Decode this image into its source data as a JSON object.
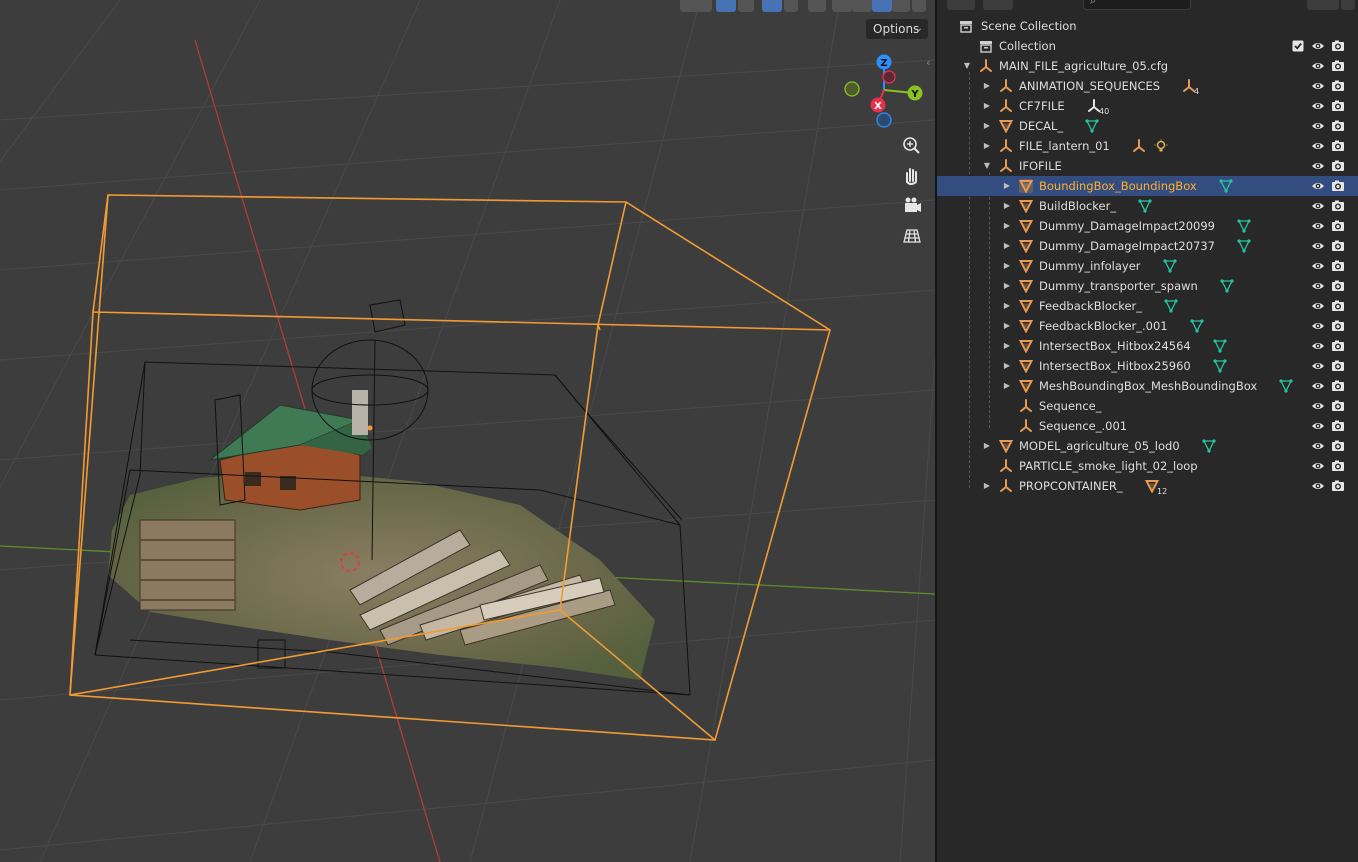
{
  "viewport": {
    "options_label": "Options",
    "header_buttons": [
      "transform-pivot",
      "snap",
      "proportional-edit",
      "overlays",
      "xray",
      "shading-wireframe",
      "shading-solid",
      "shading-material",
      "shading-rendered"
    ]
  },
  "gizmo": {
    "x_label": "X",
    "y_label": "Y",
    "z_label": "Z",
    "colors": {
      "x": "#e6314a",
      "y": "#8ac222",
      "z": "#2c8fff",
      "neg_y": "#637e2a"
    }
  },
  "nav_tools": [
    "zoom-icon",
    "hand-pan-icon",
    "camera-icon",
    "grid-perspective-icon"
  ],
  "outliner": {
    "search_placeholder": "",
    "scene_collection_label": "Scene Collection",
    "rows": [
      {
        "label": "Collection",
        "type": "collection",
        "depth": 1,
        "expand": "",
        "extras": [],
        "checkbox": true
      },
      {
        "label": "MAIN_FILE_agriculture_05.cfg",
        "type": "empty",
        "depth": 1,
        "expand": "down",
        "extras": []
      },
      {
        "label": "ANIMATION_SEQUENCES",
        "type": "empty",
        "depth": 2,
        "expand": "right",
        "extras": [
          {
            "icon": "empty",
            "count": "4"
          }
        ]
      },
      {
        "label": "CF7FILE",
        "type": "empty",
        "depth": 2,
        "expand": "right",
        "extras": [
          {
            "icon": "empty-white",
            "count": "40"
          }
        ]
      },
      {
        "label": "DECAL_",
        "type": "mesh",
        "depth": 2,
        "expand": "right",
        "extras": [
          {
            "icon": "meshdata"
          }
        ]
      },
      {
        "label": "FILE_lantern_01",
        "type": "empty",
        "depth": 2,
        "expand": "right",
        "extras": [
          {
            "icon": "empty"
          },
          {
            "icon": "light"
          }
        ]
      },
      {
        "label": "IFOFILE",
        "type": "empty",
        "depth": 2,
        "expand": "down",
        "extras": []
      },
      {
        "label": "BoundingBox_BoundingBox",
        "type": "mesh",
        "depth": 3,
        "expand": "right",
        "extras": [
          {
            "icon": "meshdata"
          }
        ],
        "selected": true
      },
      {
        "label": "BuildBlocker_",
        "type": "mesh",
        "depth": 3,
        "expand": "right",
        "extras": [
          {
            "icon": "meshdata"
          }
        ]
      },
      {
        "label": "Dummy_DamageImpact20099",
        "type": "mesh",
        "depth": 3,
        "expand": "right",
        "extras": [
          {
            "icon": "meshdata"
          }
        ]
      },
      {
        "label": "Dummy_DamageImpact20737",
        "type": "mesh",
        "depth": 3,
        "expand": "right",
        "extras": [
          {
            "icon": "meshdata"
          }
        ]
      },
      {
        "label": "Dummy_infolayer",
        "type": "mesh",
        "depth": 3,
        "expand": "right",
        "extras": [
          {
            "icon": "meshdata"
          }
        ]
      },
      {
        "label": "Dummy_transporter_spawn",
        "type": "mesh",
        "depth": 3,
        "expand": "right",
        "extras": [
          {
            "icon": "meshdata"
          }
        ]
      },
      {
        "label": "FeedbackBlocker_",
        "type": "mesh",
        "depth": 3,
        "expand": "right",
        "extras": [
          {
            "icon": "meshdata"
          }
        ]
      },
      {
        "label": "FeedbackBlocker_.001",
        "type": "mesh",
        "depth": 3,
        "expand": "right",
        "extras": [
          {
            "icon": "meshdata"
          }
        ]
      },
      {
        "label": "IntersectBox_Hitbox24564",
        "type": "mesh",
        "depth": 3,
        "expand": "right",
        "extras": [
          {
            "icon": "meshdata"
          }
        ]
      },
      {
        "label": "IntersectBox_Hitbox25960",
        "type": "mesh",
        "depth": 3,
        "expand": "right",
        "extras": [
          {
            "icon": "meshdata"
          }
        ]
      },
      {
        "label": "MeshBoundingBox_MeshBoundingBox",
        "type": "mesh",
        "depth": 3,
        "expand": "right",
        "extras": [
          {
            "icon": "meshdata"
          }
        ]
      },
      {
        "label": "Sequence_",
        "type": "empty",
        "depth": 3,
        "expand": "",
        "extras": []
      },
      {
        "label": "Sequence_.001",
        "type": "empty",
        "depth": 3,
        "expand": "",
        "extras": []
      },
      {
        "label": "MODEL_agriculture_05_lod0",
        "type": "mesh",
        "depth": 2,
        "expand": "right",
        "extras": [
          {
            "icon": "meshdata"
          }
        ]
      },
      {
        "label": "PARTICLE_smoke_light_02_loop",
        "type": "empty",
        "depth": 2,
        "expand": "",
        "extras": []
      },
      {
        "label": "PROPCONTAINER_",
        "type": "empty",
        "depth": 2,
        "expand": "right",
        "extras": [
          {
            "icon": "mesh-orange",
            "count": "12"
          }
        ]
      }
    ]
  },
  "colors": {
    "viewport_bg": "#3d3d3d",
    "selection_orange": "#f29b32",
    "selected_row": "#334d80",
    "active_text": "#ffaf29",
    "object_orange": "#e89a52",
    "meshdata_green": "#25c4a0"
  }
}
